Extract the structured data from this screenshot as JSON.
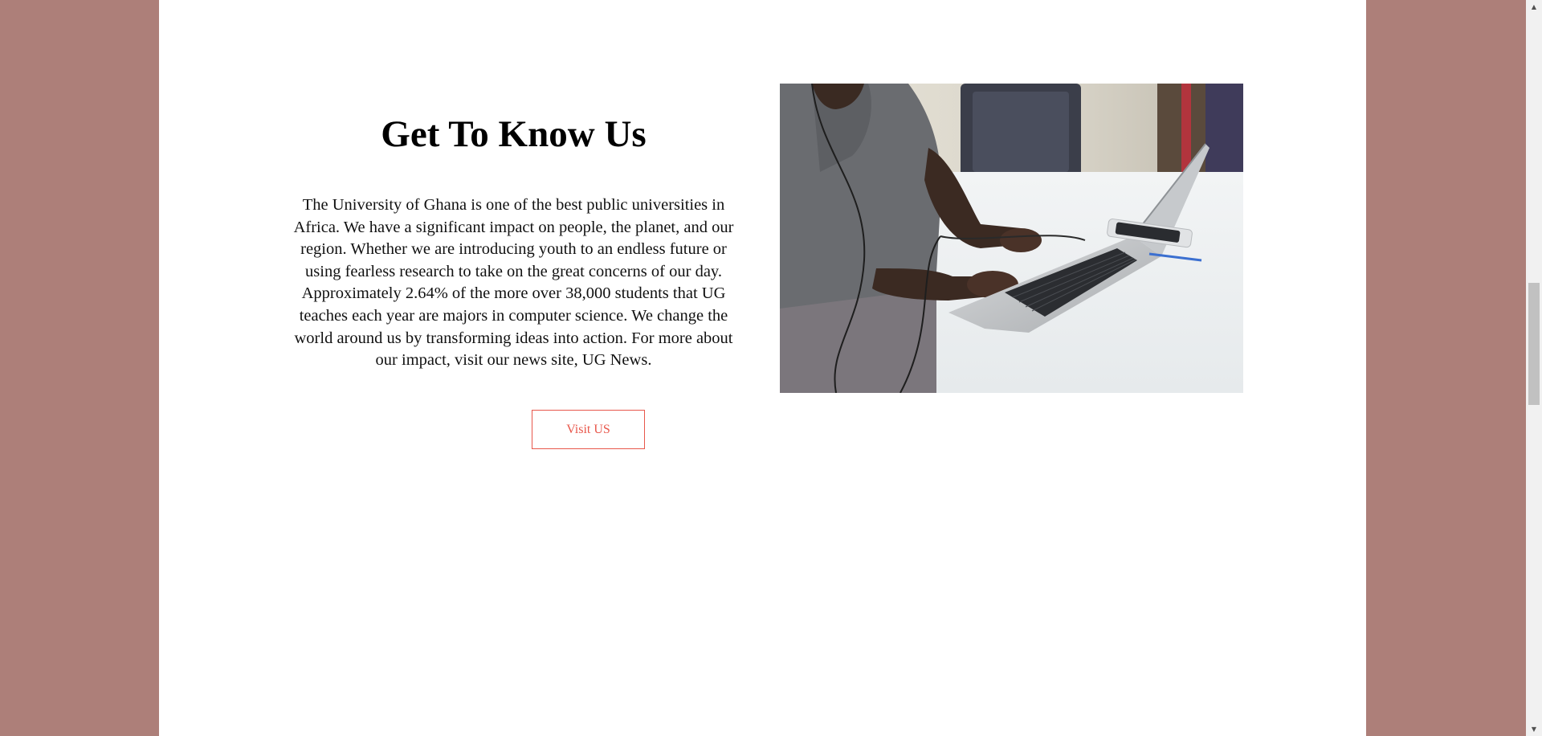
{
  "about": {
    "heading": "Get To Know Us",
    "paragraph": "The University of Ghana is one of the best public universities in Africa. We have a significant impact on people, the planet, and our region. Whether we are introducing youth to an endless future or using fearless research to take on the great concerns of our day. Approximately 2.64% of the more over 38,000 students that UG teaches each year are majors in computer science. We change the world around us by transforming ideas into action. For more about our impact, visit our news site, UG News.",
    "button_label": "Visit US"
  },
  "image": {
    "subject": "person typing on a laptop at a white desk"
  },
  "colors": {
    "background": "#ad7f79",
    "page": "#ffffff",
    "accent": "#e8574b"
  }
}
